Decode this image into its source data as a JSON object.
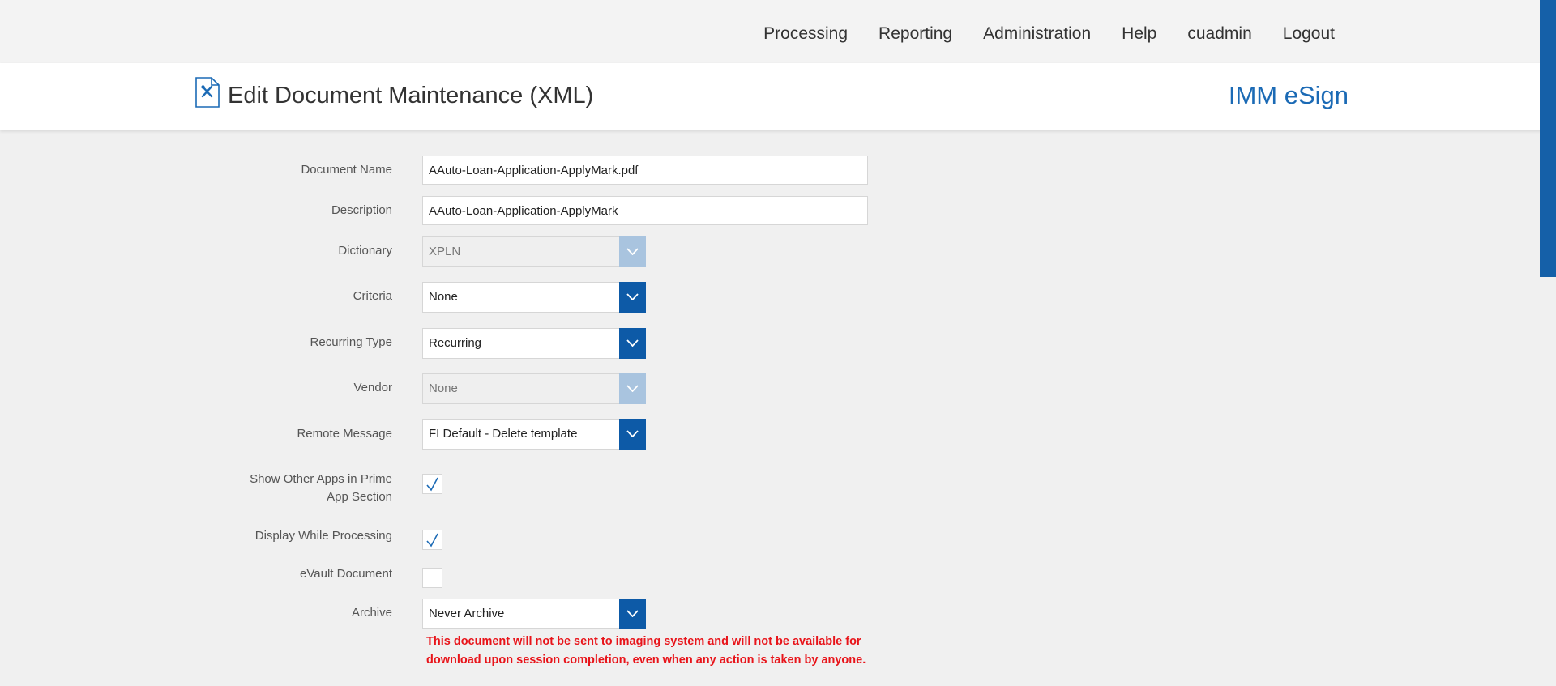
{
  "nav": {
    "items": [
      {
        "label": "Processing"
      },
      {
        "label": "Reporting"
      },
      {
        "label": "Administration"
      },
      {
        "label": "Help"
      },
      {
        "label": "cuadmin"
      },
      {
        "label": "Logout"
      }
    ]
  },
  "header": {
    "title": "Edit Document Maintenance (XML)",
    "brand": "IMM eSign"
  },
  "form": {
    "document_name": {
      "label": "Document Name",
      "value": "AAuto-Loan-Application-ApplyMark.pdf"
    },
    "description": {
      "label": "Description",
      "value": "AAuto-Loan-Application-ApplyMark"
    },
    "dictionary": {
      "label": "Dictionary",
      "value": "XPLN",
      "disabled": true
    },
    "criteria": {
      "label": "Criteria",
      "value": "None"
    },
    "recurring_type": {
      "label": "Recurring Type",
      "value": "Recurring"
    },
    "vendor": {
      "label": "Vendor",
      "value": "None",
      "disabled": true
    },
    "remote_message": {
      "label": "Remote Message",
      "value": "FI Default - Delete template"
    },
    "show_other_apps": {
      "label_line1": "Show Other Apps in Prime",
      "label_line2": "App Section",
      "checked": true
    },
    "display_while_processing": {
      "label": "Display While Processing",
      "checked": true
    },
    "evault_document": {
      "label": "eVault Document",
      "checked": false
    },
    "archive": {
      "label": "Archive",
      "value": "Never Archive",
      "warning_line1": "This document will not be sent to imaging system and will not be available for",
      "warning_line2": "download upon session completion, even when any action is taken by anyone."
    }
  },
  "icons": {
    "page": "document-edit-icon",
    "dropdown": "chevron-down-icon",
    "check": "checkmark-icon"
  },
  "colors": {
    "accent": "#0d5aa7",
    "brand": "#1b6ab5",
    "warning": "#e8141a",
    "disabled_button": "#a9c4df"
  }
}
